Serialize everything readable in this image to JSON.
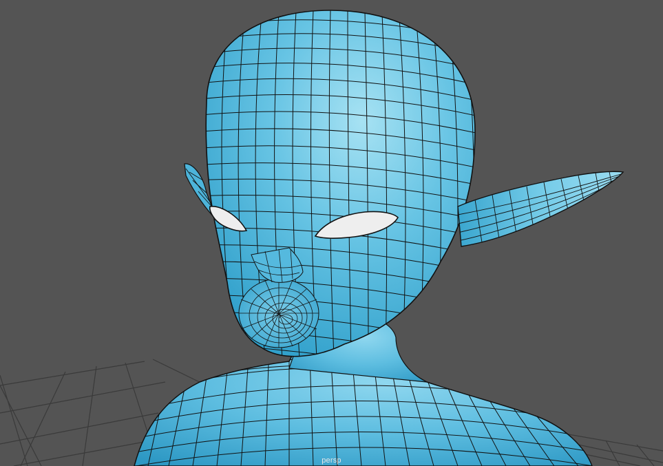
{
  "viewport": {
    "camera_name": "persp",
    "background_color": "#545454",
    "grid_color": "#3a3a3a",
    "mesh_fill_color": "#67c4e4",
    "mesh_shade_color": "#2f9fca",
    "mesh_highlight_color": "#a7e2f3",
    "wire_color": "#111111",
    "eye_color": "#eeeeee"
  },
  "scene": {
    "object": "polygon-mesh-elf-head",
    "display_mode": "smooth-shade-wireframe-on-shaded"
  }
}
